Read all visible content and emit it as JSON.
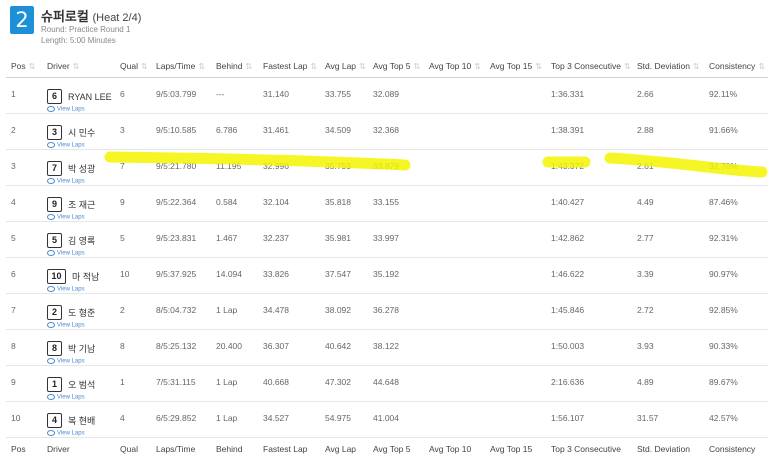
{
  "header": {
    "heat_number": "2",
    "title_korean": "슈퍼로컬",
    "title_heat": "(Heat 2/4)",
    "round": "Round: Practice Round 1",
    "length": "Length: 5:00 Minutes"
  },
  "columns": [
    "Pos",
    "Driver",
    "Qual",
    "Laps/Time",
    "Behind",
    "Fastest Lap",
    "Avg Lap",
    "Avg Top 5",
    "Avg Top 10",
    "Avg Top 15",
    "Top 3 Consecutive",
    "Std. Deviation",
    "Consistency"
  ],
  "view_laps_label": "View Laps",
  "rows": [
    {
      "pos": "1",
      "kart": "6",
      "driver": "RYAN LEE",
      "qual": "6",
      "laps": "9/5:03.799",
      "behind": "---",
      "fastest": "31.140",
      "avg": "33.755",
      "top5": "32.089",
      "top10": "",
      "top15": "",
      "top3c": "1:36.331",
      "std": "2.66",
      "cons": "92.11%"
    },
    {
      "pos": "2",
      "kart": "3",
      "driver": "시 민수",
      "qual": "3",
      "laps": "9/5:10.585",
      "behind": "6.786",
      "fastest": "31.461",
      "avg": "34.509",
      "top5": "32.368",
      "top10": "",
      "top15": "",
      "top3c": "1:38.391",
      "std": "2.88",
      "cons": "91.66%"
    },
    {
      "pos": "3",
      "kart": "7",
      "driver": "박 성광",
      "qual": "7",
      "laps": "9/5:21.780",
      "behind": "11.195",
      "fastest": "32.996",
      "avg": "35.753",
      "top5": "33.879",
      "top10": "",
      "top15": "",
      "top3c": "1:43.372",
      "std": "2.61",
      "cons": "92.70%"
    },
    {
      "pos": "4",
      "kart": "9",
      "driver": "조 재근",
      "qual": "9",
      "laps": "9/5:22.364",
      "behind": "0.584",
      "fastest": "32.104",
      "avg": "35.818",
      "top5": "33.155",
      "top10": "",
      "top15": "",
      "top3c": "1:40.427",
      "std": "4.49",
      "cons": "87.46%"
    },
    {
      "pos": "5",
      "kart": "5",
      "driver": "김 영록",
      "qual": "5",
      "laps": "9/5:23.831",
      "behind": "1.467",
      "fastest": "32.237",
      "avg": "35.981",
      "top5": "33.997",
      "top10": "",
      "top15": "",
      "top3c": "1:42.862",
      "std": "2.77",
      "cons": "92.31%"
    },
    {
      "pos": "6",
      "kart": "10",
      "driver": "마 적남",
      "qual": "10",
      "laps": "9/5:37.925",
      "behind": "14.094",
      "fastest": "33.826",
      "avg": "37.547",
      "top5": "35.192",
      "top10": "",
      "top15": "",
      "top3c": "1:46.622",
      "std": "3.39",
      "cons": "90.97%"
    },
    {
      "pos": "7",
      "kart": "2",
      "driver": "도 형준",
      "qual": "2",
      "laps": "8/5:04.732",
      "behind": "1 Lap",
      "fastest": "34.478",
      "avg": "38.092",
      "top5": "36.278",
      "top10": "",
      "top15": "",
      "top3c": "1:45.846",
      "std": "2.72",
      "cons": "92.85%"
    },
    {
      "pos": "8",
      "kart": "8",
      "driver": "박 기남",
      "qual": "8",
      "laps": "8/5:25.132",
      "behind": "20.400",
      "fastest": "36.307",
      "avg": "40.642",
      "top5": "38.122",
      "top10": "",
      "top15": "",
      "top3c": "1:50.003",
      "std": "3.93",
      "cons": "90.33%"
    },
    {
      "pos": "9",
      "kart": "1",
      "driver": "오 범석",
      "qual": "1",
      "laps": "7/5:31.115",
      "behind": "1 Lap",
      "fastest": "40.668",
      "avg": "47.302",
      "top5": "44.648",
      "top10": "",
      "top15": "",
      "top3c": "2:16.636",
      "std": "4.89",
      "cons": "89.67%"
    },
    {
      "pos": "10",
      "kart": "4",
      "driver": "복 현배",
      "qual": "4",
      "laps": "6/5:29.852",
      "behind": "1 Lap",
      "fastest": "34.527",
      "avg": "54.975",
      "top5": "41.004",
      "top10": "",
      "top15": "",
      "top3c": "1:56.107",
      "std": "31.57",
      "cons": "42.57%"
    }
  ],
  "colors": {
    "badge": "#1e90d8",
    "highlight": "#f5f500",
    "link": "#4a8ad0"
  }
}
